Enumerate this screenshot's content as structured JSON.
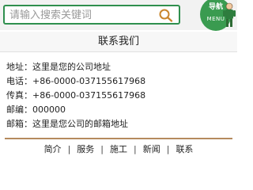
{
  "search": {
    "placeholder": "请输入搜索关键词",
    "icon": "search-icon"
  },
  "nav_menu": {
    "label": "导航",
    "sub_label": "MENU",
    "icon": "menu-mascot-icon"
  },
  "contact": {
    "title": "联系我们",
    "rows": [
      {
        "label": "地址：",
        "value": "这里是您的公司地址"
      },
      {
        "label": "电话：",
        "value": "+86-0000-037155617968"
      },
      {
        "label": "传真：",
        "value": "+86-0000-037155617968"
      },
      {
        "label": "邮编：",
        "value": "000000"
      },
      {
        "label": "邮箱：",
        "value": "这里是您公司的邮箱地址"
      }
    ]
  },
  "footer": {
    "links": [
      "简介",
      "服务",
      "施工",
      "新闻",
      "联系"
    ],
    "separator": "|"
  },
  "colors": {
    "accent": "#2f8f4e",
    "divider": "#b58a5e"
  }
}
